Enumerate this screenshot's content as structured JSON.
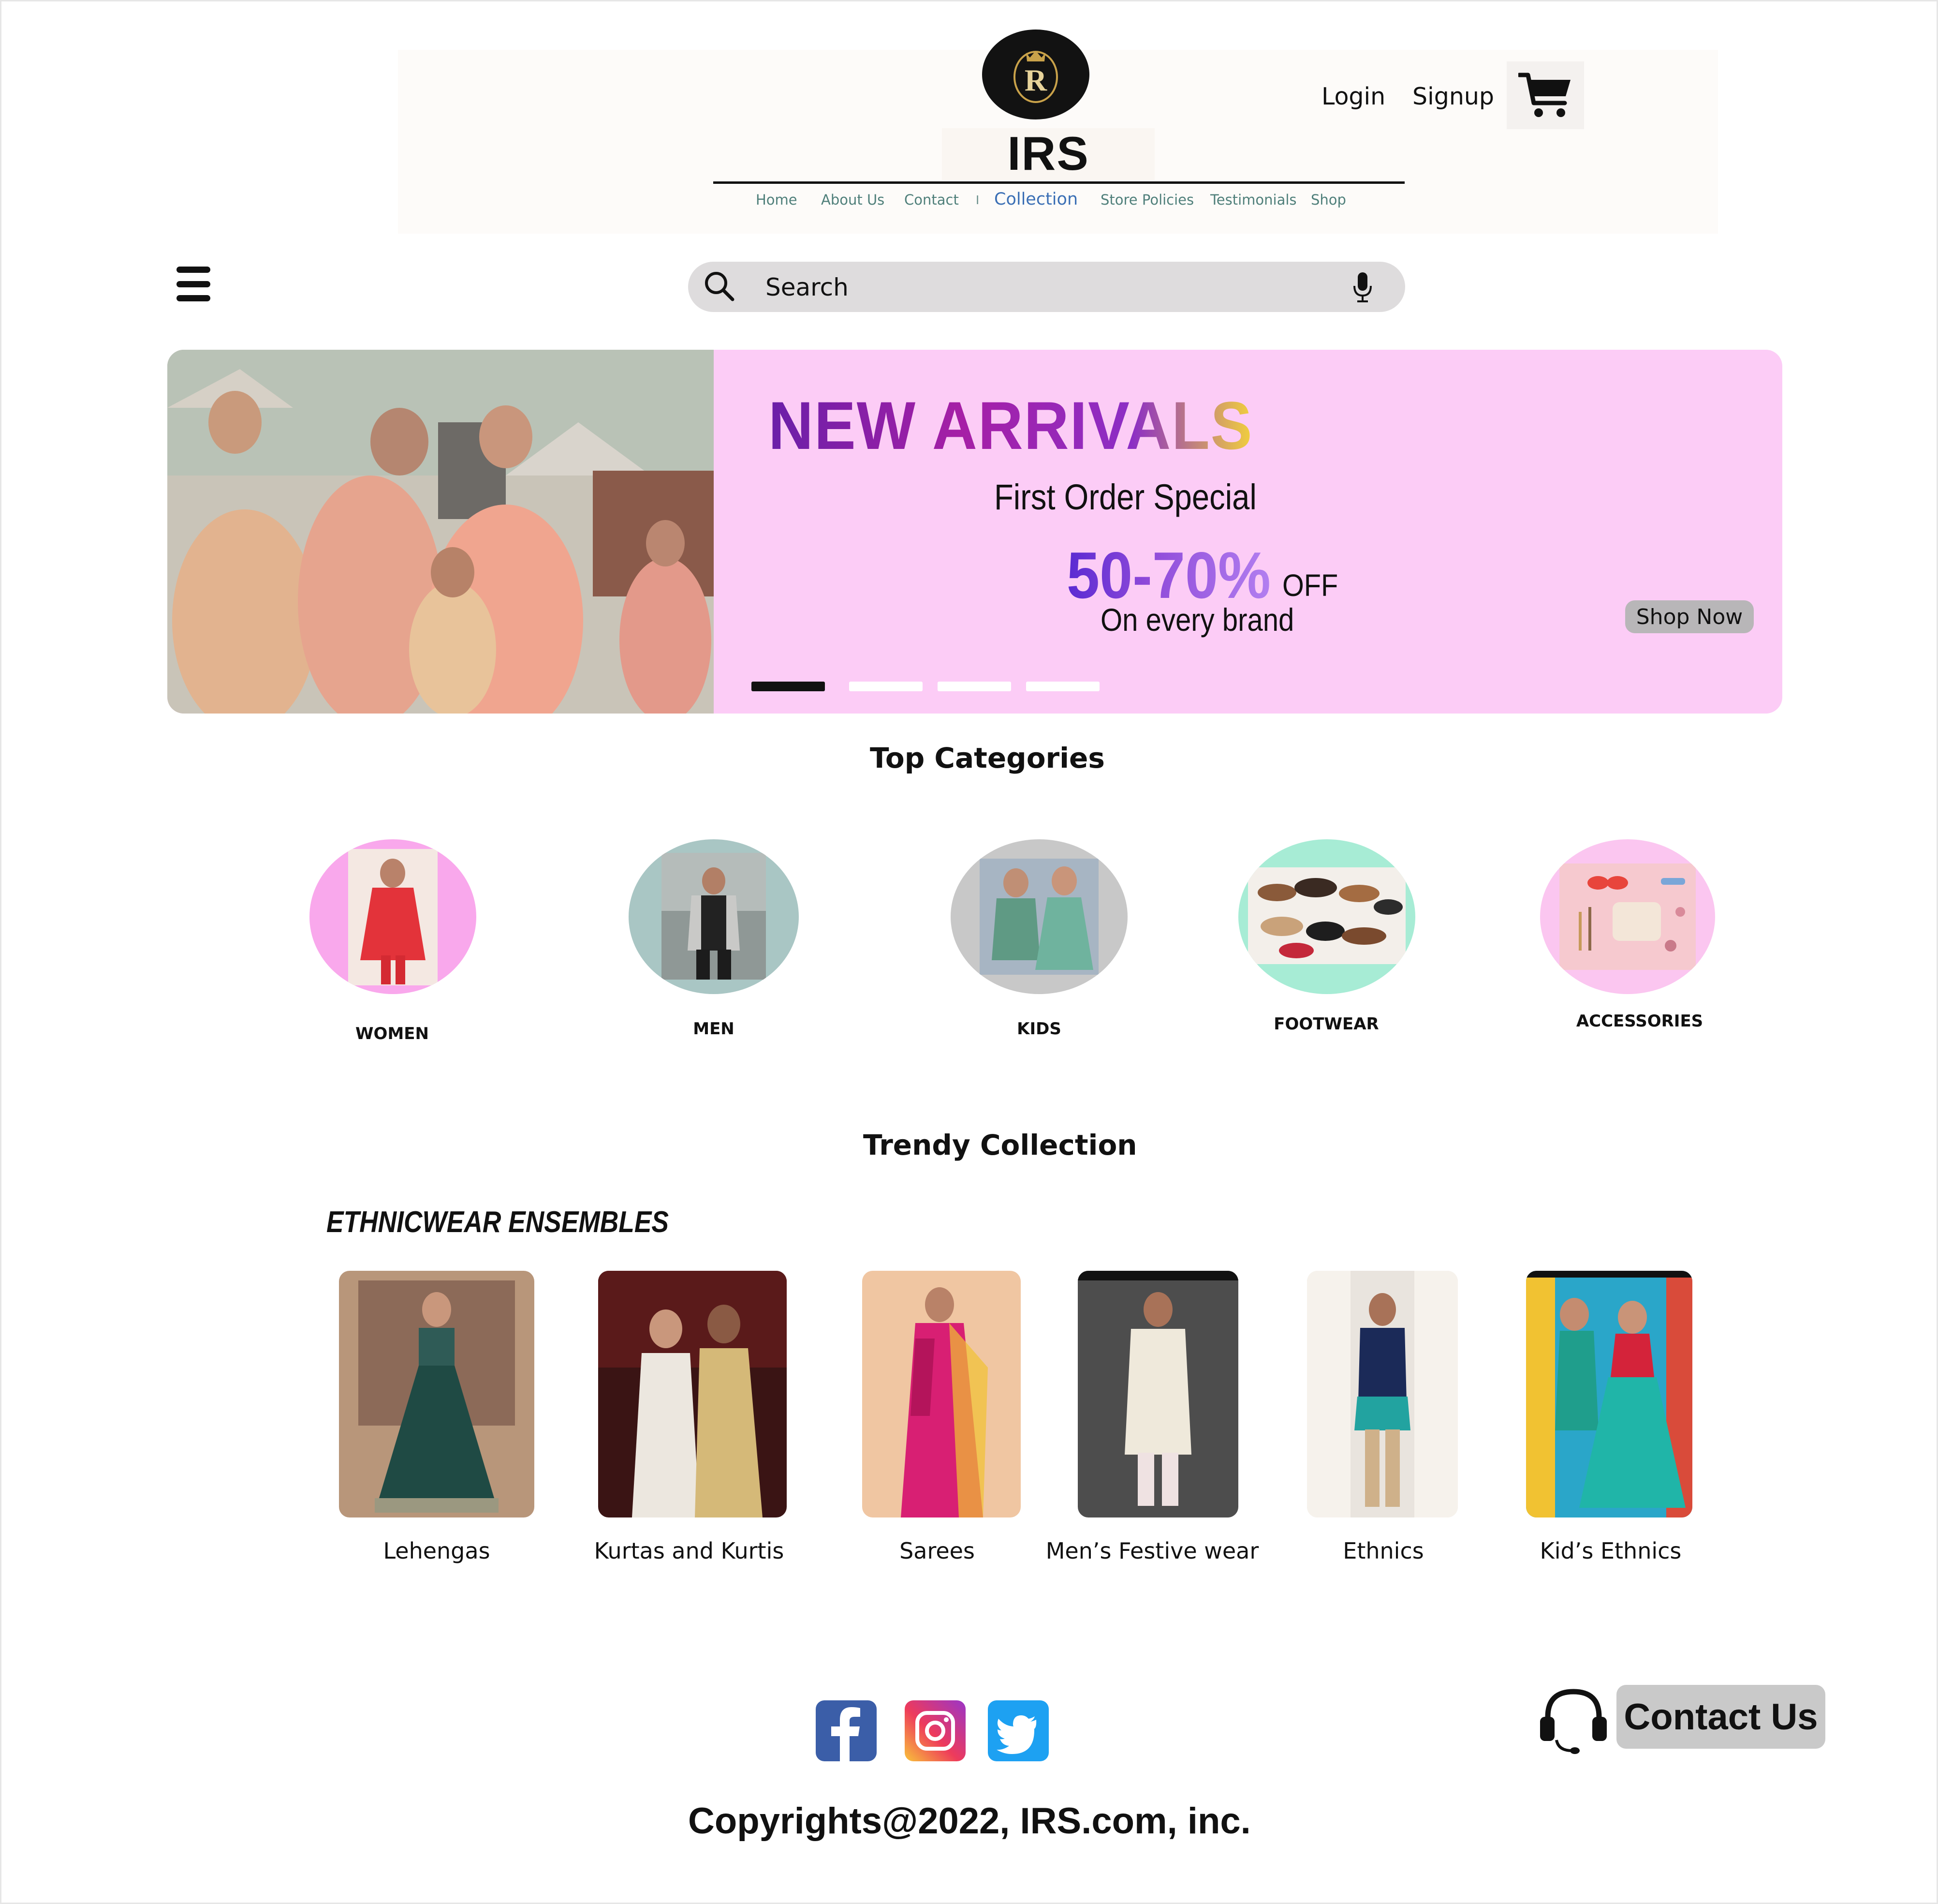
{
  "header": {
    "brand": "IRS",
    "logo_letter": "R",
    "nav": [
      "Home",
      "About Us",
      "Contact",
      "Collection",
      "Store Policies",
      "Testimonials",
      "Shop"
    ],
    "nav_active": "Collection",
    "nav_separator": "I",
    "login": "Login",
    "signup": "Signup",
    "cart_icon": "cart-icon"
  },
  "search": {
    "placeholder": "Search",
    "icons": [
      "search-icon",
      "microphone-icon"
    ]
  },
  "menu_icon": "hamburger-menu-icon",
  "hero": {
    "title": "NEW ARRIVALS",
    "subtitle": "First Order Special",
    "discount": "50-70%",
    "discount_suffix": "OFF",
    "discount_note": "On every brand",
    "cta": "Shop Now",
    "slides_total": 4,
    "active_slide": 1,
    "colors": {
      "background": "#fcccf6",
      "title_start": "#6a1fa8",
      "discount": "#7a3fd6"
    }
  },
  "categories": {
    "title": "Top  Categories",
    "items": [
      {
        "label": "WOMEN",
        "bg": "#f9a8ec"
      },
      {
        "label": "MEN",
        "bg": "#a9c6c4"
      },
      {
        "label": "KIDS",
        "bg": "#c8c8c8"
      },
      {
        "label": "FOOTWEAR",
        "bg": "#a7ecd5"
      },
      {
        "label": "ACCESSORIES",
        "bg": "#fbc6f0"
      }
    ]
  },
  "trendy": {
    "title": "Trendy  Collection",
    "subheading": "ETHNICWEAR ENSEMBLES",
    "products": [
      {
        "label": "Lehengas"
      },
      {
        "label": "Kurtas and Kurtis"
      },
      {
        "label": "Sarees"
      },
      {
        "label": "Men’s Festive wear"
      },
      {
        "label": "Ethnics"
      },
      {
        "label": "Kid’s Ethnics"
      }
    ]
  },
  "footer": {
    "social": [
      "facebook-icon",
      "instagram-icon",
      "twitter-icon"
    ],
    "contact_button": "Contact Us",
    "copyright": "Copyrights@2022, IRS.com, inc."
  }
}
